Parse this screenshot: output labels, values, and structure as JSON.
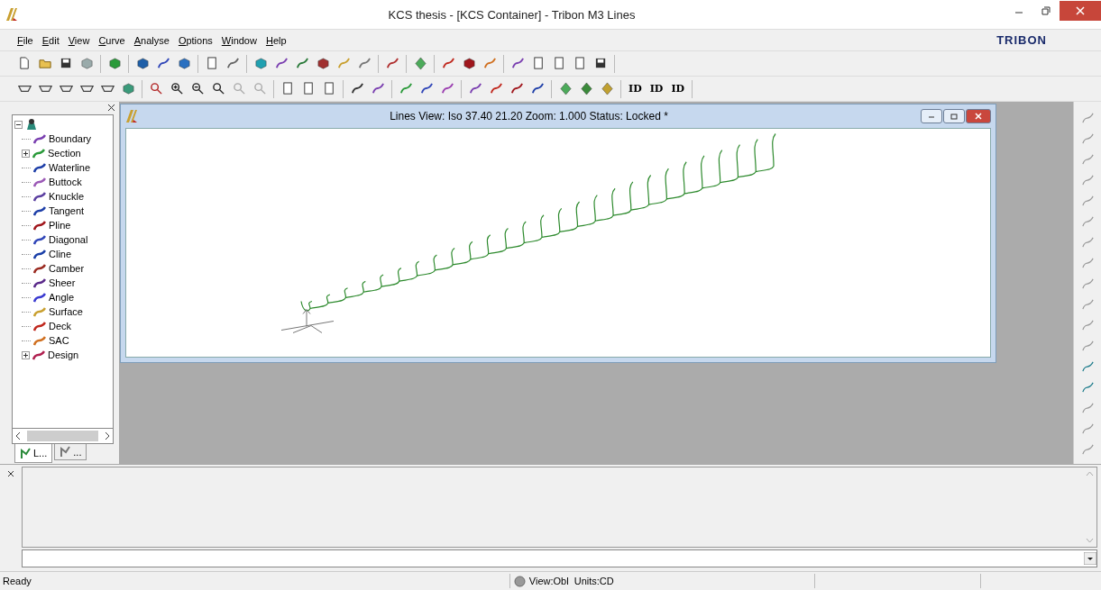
{
  "window": {
    "title": "KCS thesis - [KCS Container] - Tribon M3 Lines"
  },
  "menu": [
    {
      "label": "File"
    },
    {
      "label": "Edit"
    },
    {
      "label": "View"
    },
    {
      "label": "Curve"
    },
    {
      "label": "Analyse"
    },
    {
      "label": "Options"
    },
    {
      "label": "Window"
    },
    {
      "label": "Help"
    }
  ],
  "logo": "TRIBON",
  "id_buttons": [
    "ID",
    "ID",
    "ID"
  ],
  "tree": {
    "expanded": true,
    "children": [
      {
        "label": "Boundary"
      },
      {
        "label": "Section",
        "expanded": false
      },
      {
        "label": "Waterline"
      },
      {
        "label": "Buttock"
      },
      {
        "label": "Knuckle"
      },
      {
        "label": "Tangent"
      },
      {
        "label": "Pline"
      },
      {
        "label": "Diagonal"
      },
      {
        "label": "Cline"
      },
      {
        "label": "Camber"
      },
      {
        "label": "Sheer"
      },
      {
        "label": "Angle"
      },
      {
        "label": "Surface"
      },
      {
        "label": "Deck"
      },
      {
        "label": "SAC"
      },
      {
        "label": "Design",
        "expanded": false
      }
    ]
  },
  "panel_tabs": [
    {
      "label": "L...",
      "selected": true
    },
    {
      "label": "...",
      "selected": false
    }
  ],
  "lines_view": {
    "title": "Lines View: Iso 37.40 21.20  Zoom: 1.000  Status: Locked *"
  },
  "status_bar": {
    "message": "Ready",
    "view": "View:Obl  Units:CD"
  }
}
